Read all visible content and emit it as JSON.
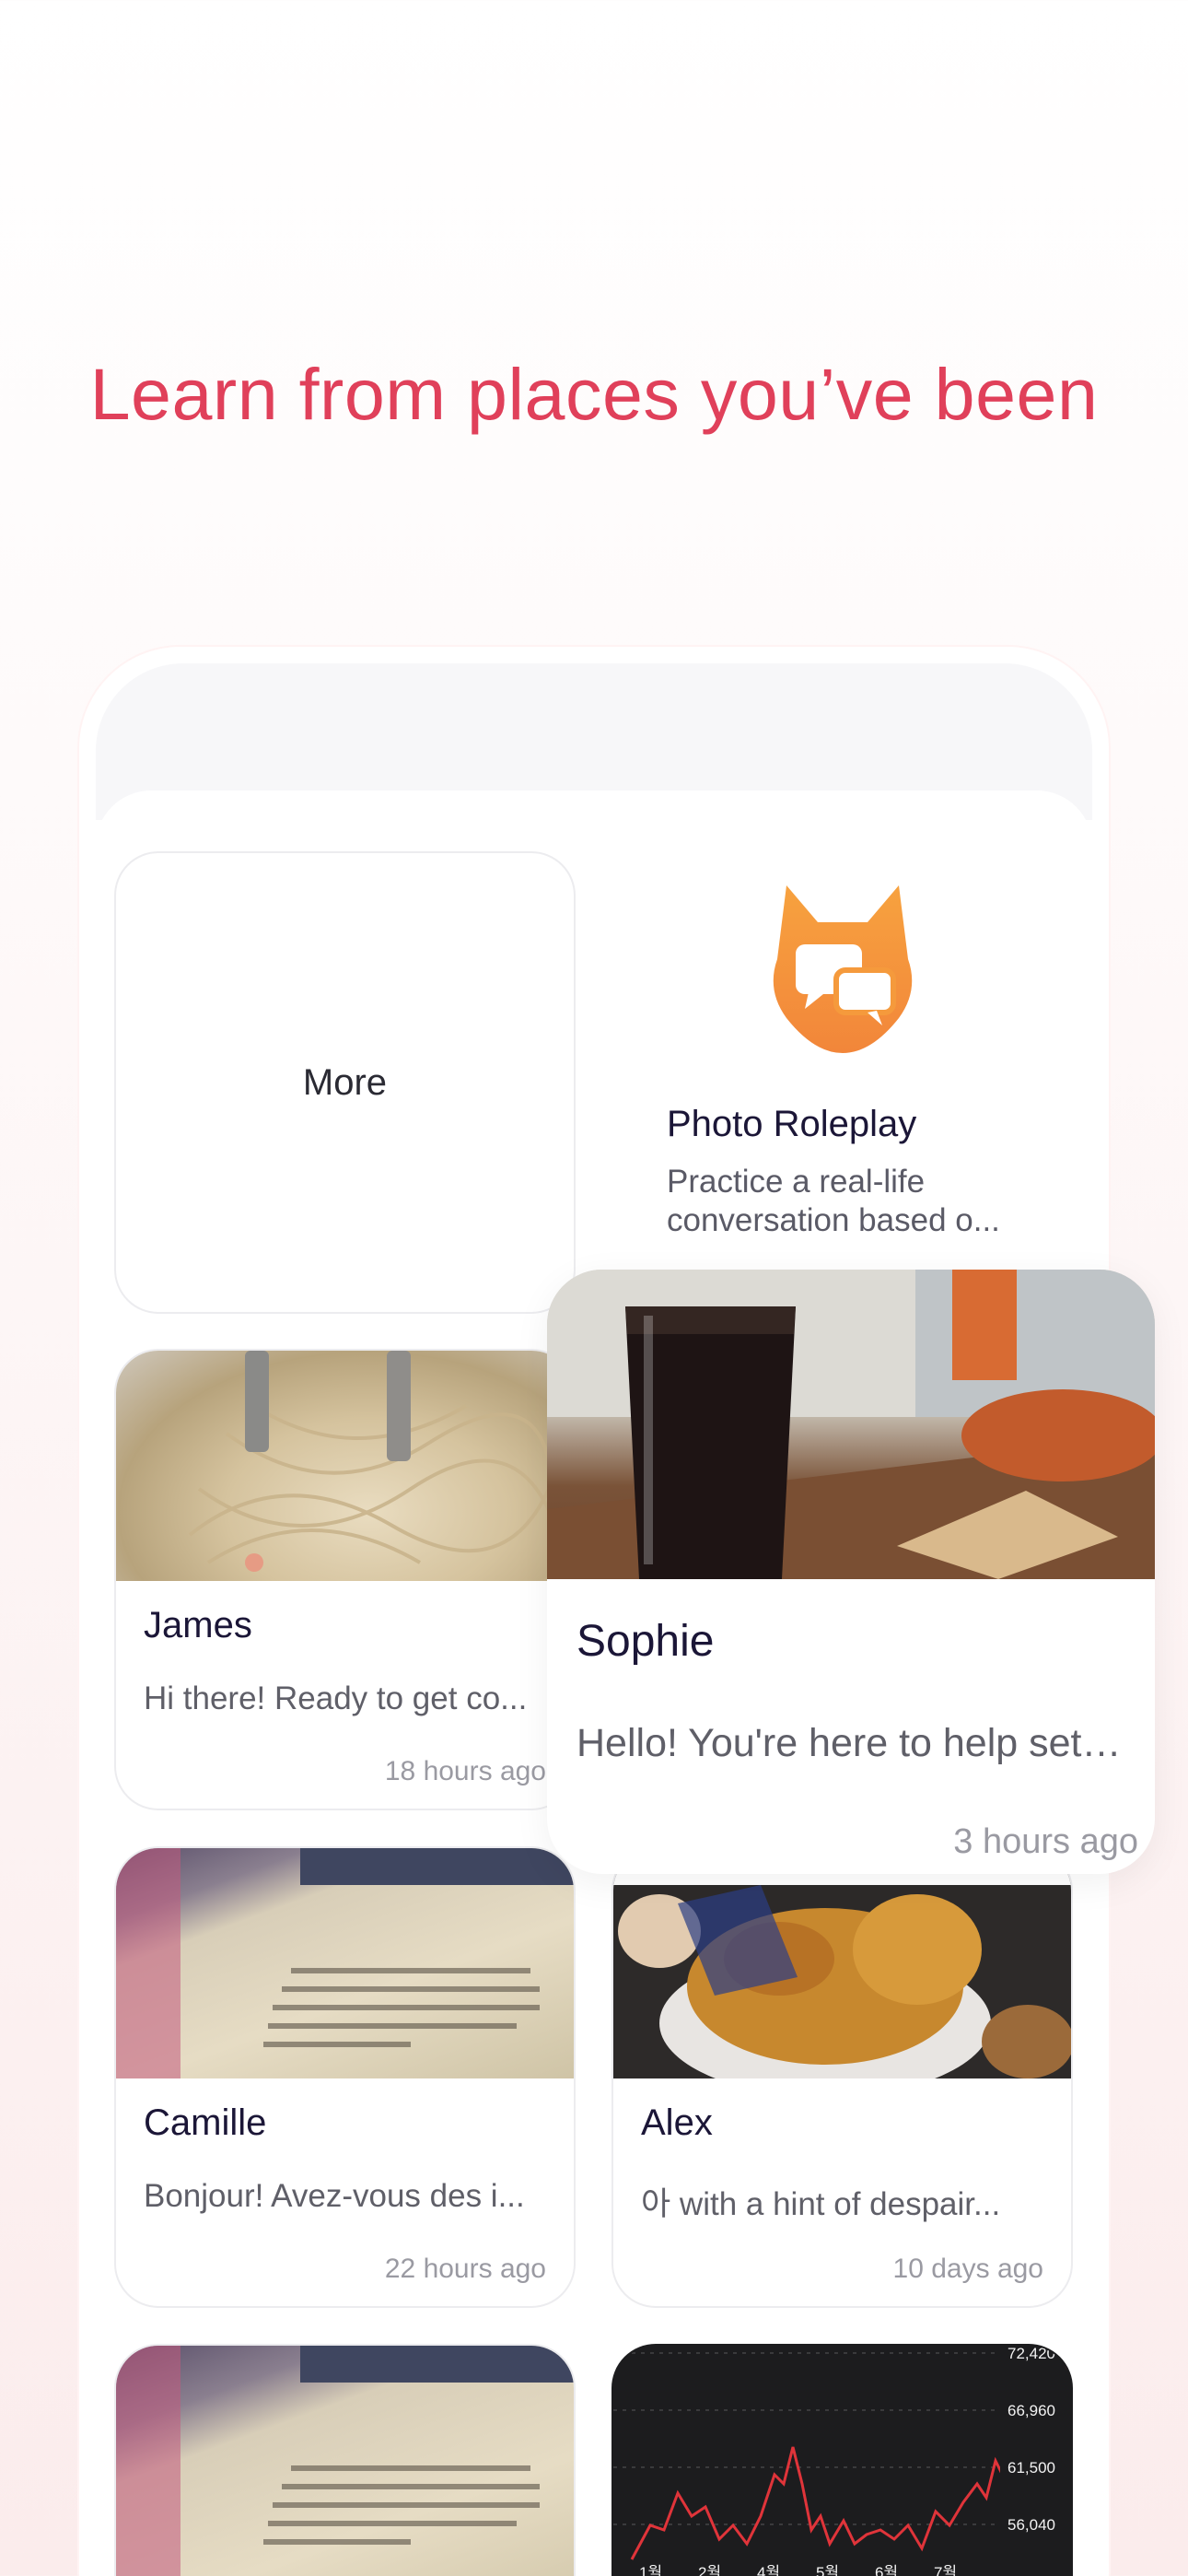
{
  "headline": "Learn from places you’ve been",
  "more_label": "More",
  "feature": {
    "title": "Photo Roleplay",
    "description": "Practice a real-life conversation based o..."
  },
  "conversations": [
    {
      "name": "James",
      "message": "Hi there! Ready to get co...",
      "time": "18 hours ago"
    },
    {
      "name": "Sophie",
      "message": "Hello! You're here to help set u...",
      "time": "3 hours ago"
    },
    {
      "name": "Camille",
      "message": "Bonjour! Avez-vous des i...",
      "time": "22 hours ago"
    },
    {
      "name": "Alex",
      "message": "아 with a hint of despair...",
      "time": "10 days ago"
    }
  ],
  "chart_preview": {
    "price_labels": [
      "72,420",
      "66,960",
      "61,500",
      "56,040"
    ],
    "month_labels": [
      "1월",
      "2월",
      "4월",
      "5월",
      "6월",
      "7월"
    ],
    "line_color": "#e0343a"
  },
  "colors": {
    "accent": "#e0405a",
    "fox": "#f59a3c"
  }
}
